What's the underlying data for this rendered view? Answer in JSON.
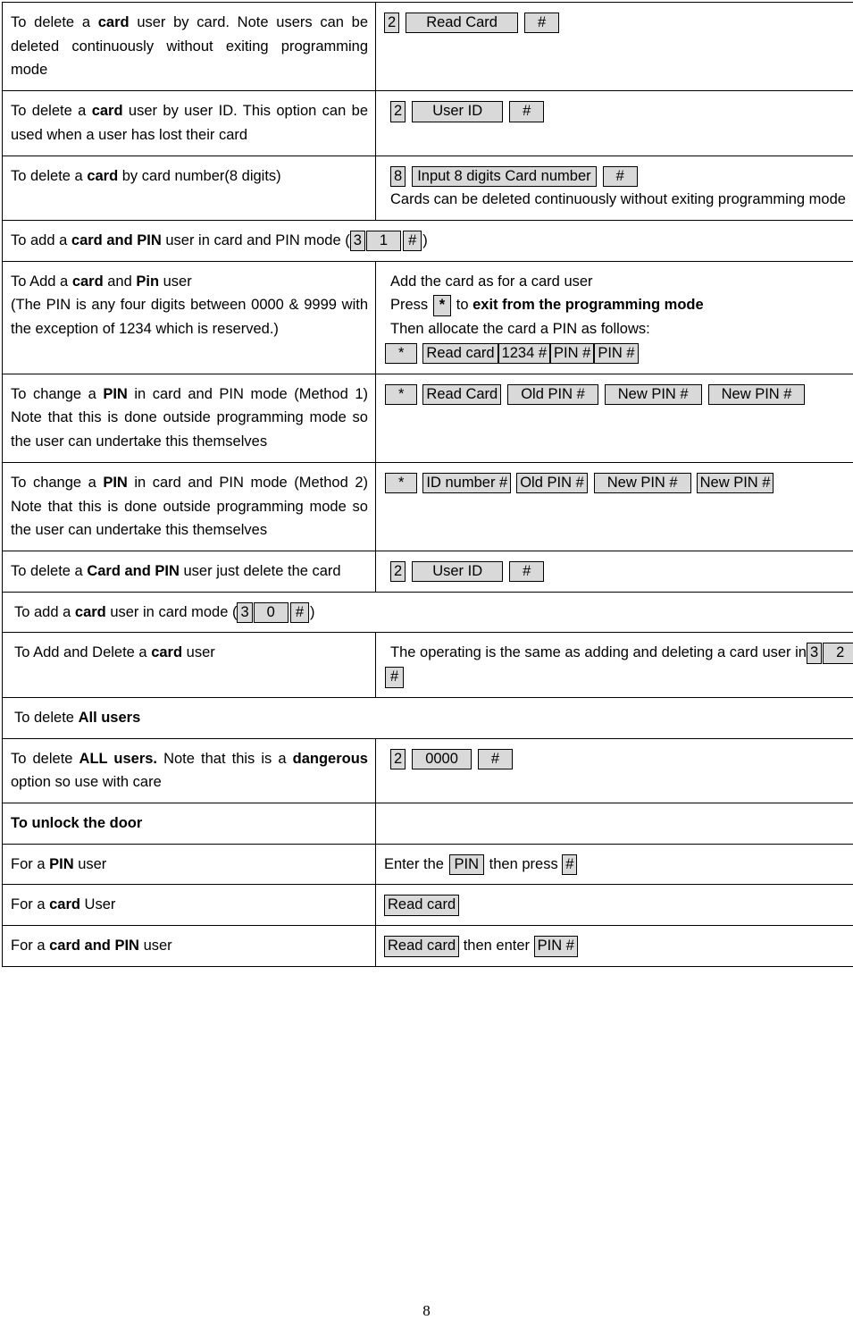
{
  "document": {
    "page_number": "8"
  },
  "rows": [
    {
      "id": "delete-card-user-by-card",
      "left_text_1": "To delete a ",
      "left_bold_1": "card",
      "left_text_2": " user by card. Note users can be deleted continuously without exiting programming mode",
      "keys": [
        "2",
        "Read Card",
        "#"
      ]
    },
    {
      "id": "delete-card-user-by-user-id",
      "left_text_1": "To delete a ",
      "left_bold_1": "card",
      "left_text_2": " user by user ID. This option can be used when a user has lost their card",
      "keys": [
        "2",
        "User ID",
        "#"
      ]
    },
    {
      "id": "delete-card-by-card-number",
      "left_text_1": "To delete a ",
      "left_bold_1": "card",
      "left_text_2": " by card number(8 digits)",
      "keys": [
        "8",
        "Input 8 digits Card number",
        "#"
      ],
      "note": "Cards can be deleted continuously without exiting programming mode"
    },
    {
      "id": "section-add-card-and-pin",
      "section_text_1": "To add a ",
      "section_bold_1": "card and PIN",
      "section_text_2": " user in card and PIN mode (",
      "section_keys": [
        "3",
        "1",
        "#"
      ],
      "section_text_3": ")"
    },
    {
      "id": "add-card-and-pin-user",
      "left_text_1": "To Add a ",
      "left_bold_1": "card",
      "left_text_2": " and ",
      "left_bold_2": "Pin",
      "left_text_3": " user",
      "left_para_2": "(The PIN is any four digits between 0000 & 9999 with the exception of 1234 which is reserved.)",
      "right_line_1": "Add the card as for a card user",
      "right_line_2_pre": "Press ",
      "right_line_2_key": "*",
      "right_line_2_mid": " to ",
      "right_line_2_bold": "exit from the programming mode",
      "right_line_3": "Then allocate the card a PIN as follows:",
      "keys": [
        "*",
        "Read card",
        "1234 #",
        "PIN #",
        "PIN #"
      ]
    },
    {
      "id": "change-pin-method-1",
      "left_text_1": "To change a ",
      "left_bold_1": "PIN",
      "left_text_2": " in card and PIN mode (Method 1) Note that this is done outside programming mode so the user can undertake this themselves",
      "keys": [
        "*",
        "Read Card",
        "Old PIN #",
        "New PIN #",
        "New PIN #"
      ]
    },
    {
      "id": "change-pin-method-2",
      "left_text_1": "To change a ",
      "left_bold_1": "PIN",
      "left_text_2": " in card and PIN mode (Method 2) Note that this is done outside programming mode so the user can undertake this themselves",
      "keys": [
        "*",
        "ID number #",
        "Old PIN #",
        "New PIN #",
        "New PIN #"
      ]
    },
    {
      "id": "delete-card-and-pin-user",
      "left_text_1": "To delete a ",
      "left_bold_1": "Card and PIN",
      "left_text_2": " user just delete the card",
      "keys": [
        "2",
        "User ID",
        "#"
      ]
    },
    {
      "id": "section-add-card-user-card-mode",
      "section_text_1": "To add a ",
      "section_bold_1": "card",
      "section_text_2": " user in card mode (",
      "section_keys": [
        "3",
        "0",
        "#"
      ],
      "section_text_3": ")"
    },
    {
      "id": "add-delete-card-user",
      "left_text_1": "To Add and Delete a ",
      "left_bold_1": "card",
      "left_text_2": " user",
      "right_line_1": "The operating is the same as adding and deleting a card user in ",
      "keys": [
        "3",
        "2",
        "#"
      ]
    },
    {
      "id": "section-delete-all-users",
      "section_text_1": "To delete ",
      "section_bold_1": "All users"
    },
    {
      "id": "delete-all-users",
      "left_text_1": "To delete ",
      "left_bold_1": "ALL users.",
      "left_text_2": " Note that this is a ",
      "left_bold_2": "dangerous",
      "left_text_3": " option so use with care",
      "keys": [
        "2",
        "0000",
        "#"
      ]
    },
    {
      "id": "section-unlock-the-door",
      "section_bold_1": "To unlock the door"
    },
    {
      "id": "unlock-pin-user",
      "left_text_1": "For a ",
      "left_bold_1": "PIN",
      "left_text_2": " user",
      "right_pre": "Enter the ",
      "right_key_1": "PIN",
      "right_mid": " then press ",
      "right_key_2": "#"
    },
    {
      "id": "unlock-card-user",
      "left_text_1": "For a ",
      "left_bold_1": "card",
      "left_text_2": " User",
      "right_key_1": "Read card"
    },
    {
      "id": "unlock-card-and-pin-user",
      "left_text_1": "For a ",
      "left_bold_1": "card and PIN",
      "left_text_2": " user",
      "right_key_1": "Read card",
      "right_mid": " then enter ",
      "right_key_2": "PIN #"
    }
  ]
}
